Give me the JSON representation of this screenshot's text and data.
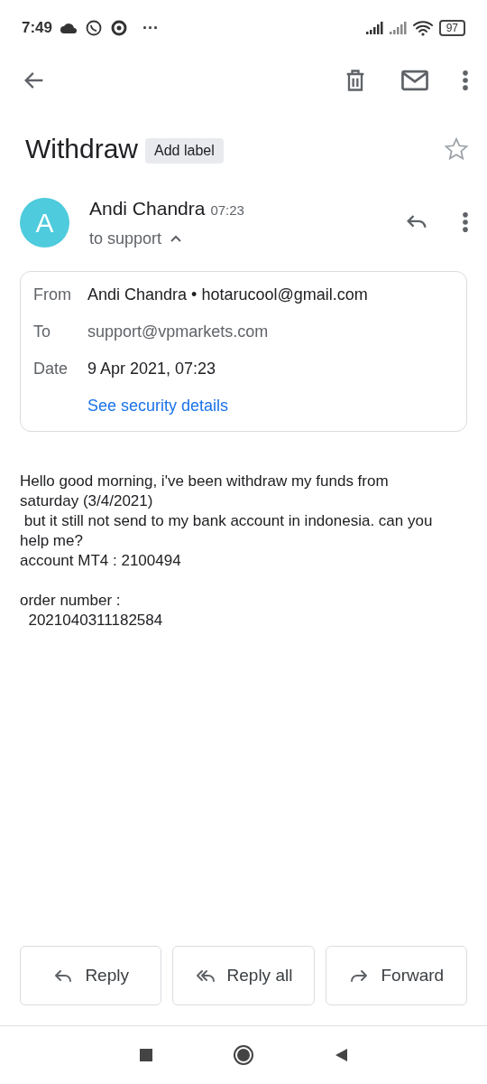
{
  "status_bar": {
    "time": "7:49",
    "more": "···",
    "battery": "97"
  },
  "email": {
    "subject": "Withdraw",
    "label_button": "Add label",
    "starred": false,
    "sender": {
      "initial": "A",
      "name": "Andi Chandra",
      "time": "07:23",
      "recipients": "to support",
      "expanded": true
    },
    "details": [
      {
        "label": "From",
        "value": "Andi Chandra • hotarucool@gmail.com"
      },
      {
        "label": "To",
        "value": "support@vpmarkets.com"
      },
      {
        "label": "Date",
        "value": "9 Apr 2021, 07:23"
      }
    ],
    "security_link": "See security details",
    "body": "Hello good morning, i've been withdraw my funds from saturday (3/4/2021)\n but it still not send to my bank account in indonesia. can you help me?\naccount MT4 : 2100494\n\norder number :\n  2021040311182584"
  },
  "actions": [
    {
      "kind": "reply",
      "label": "Reply"
    },
    {
      "kind": "reply_all",
      "label": "Reply all"
    },
    {
      "kind": "forward",
      "label": "Forward"
    }
  ]
}
